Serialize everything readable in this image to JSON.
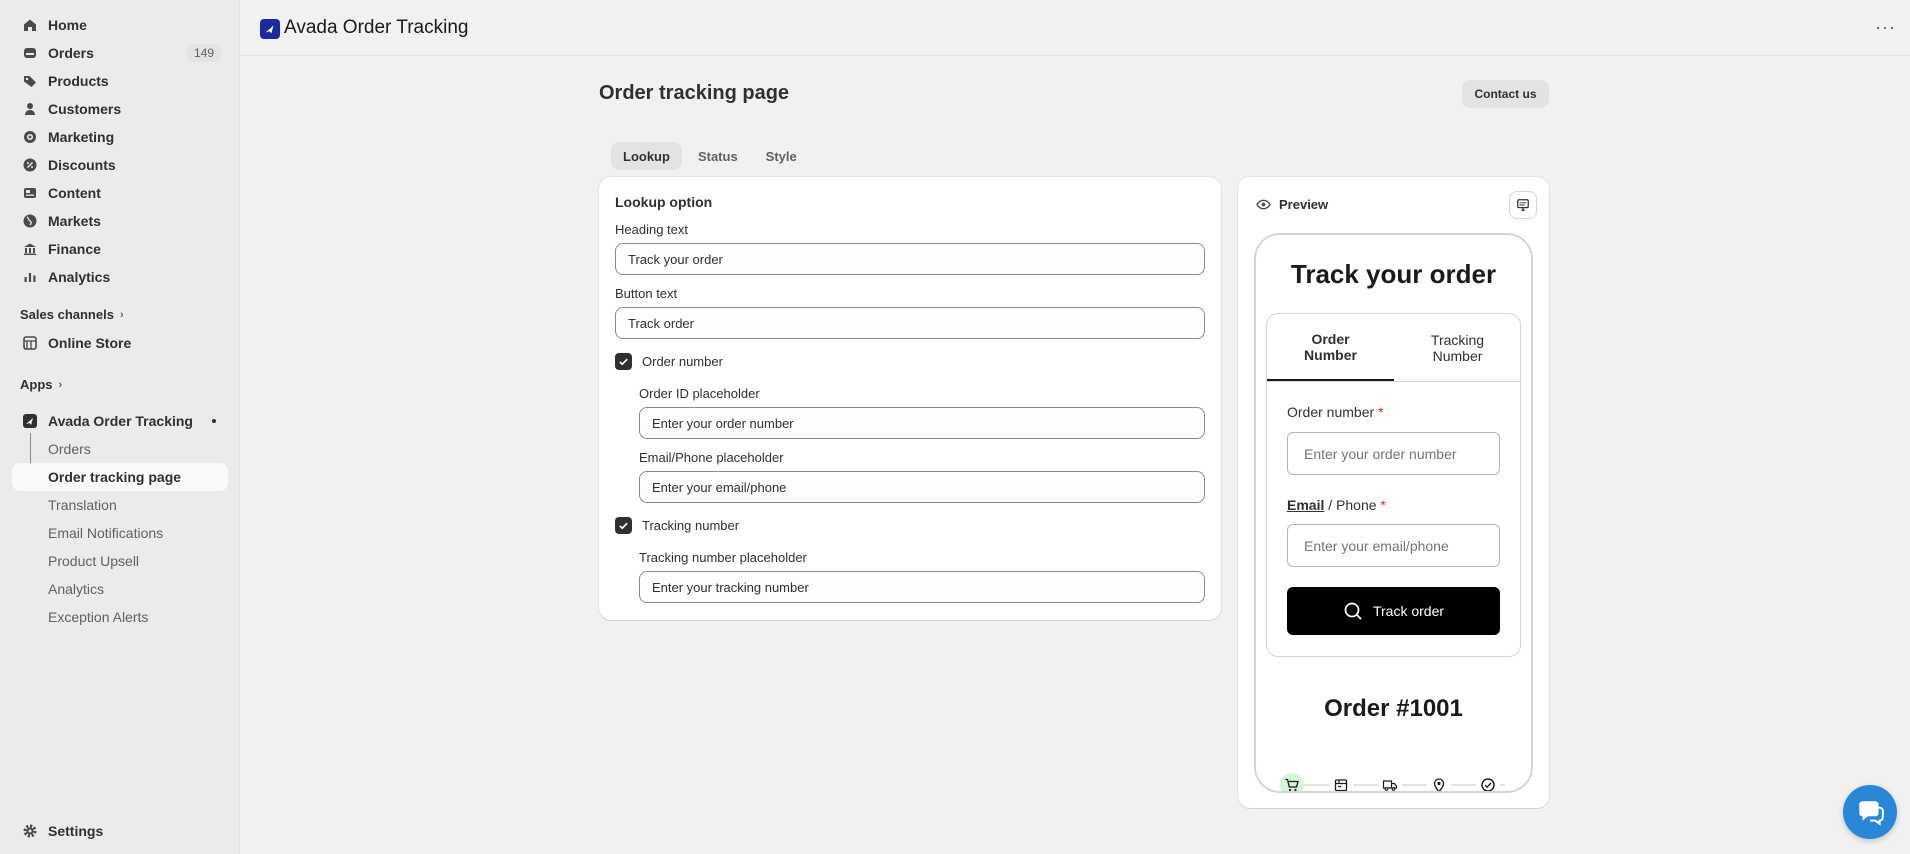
{
  "sidebar": {
    "items": [
      {
        "label": "Home",
        "icon": "home-icon"
      },
      {
        "label": "Orders",
        "icon": "orders-icon",
        "badge": "149"
      },
      {
        "label": "Products",
        "icon": "tag-icon"
      },
      {
        "label": "Customers",
        "icon": "person-icon"
      },
      {
        "label": "Marketing",
        "icon": "target-icon"
      },
      {
        "label": "Discounts",
        "icon": "discount-icon"
      },
      {
        "label": "Content",
        "icon": "content-icon"
      },
      {
        "label": "Markets",
        "icon": "globe-icon"
      },
      {
        "label": "Finance",
        "icon": "bank-icon"
      },
      {
        "label": "Analytics",
        "icon": "chart-icon"
      }
    ],
    "sales_channels_label": "Sales channels",
    "online_store_label": "Online Store",
    "apps_label": "Apps",
    "app_name": "Avada Order Tracking",
    "app_sub_items": [
      "Orders",
      "Order tracking page",
      "Translation",
      "Email Notifications",
      "Product Upsell",
      "Analytics",
      "Exception Alerts"
    ],
    "settings_label": "Settings"
  },
  "header": {
    "app_title": "Avada Order Tracking"
  },
  "page": {
    "title": "Order tracking page",
    "contact_label": "Contact us",
    "tabs": [
      "Lookup",
      "Status",
      "Style"
    ],
    "active_tab": "Lookup"
  },
  "form": {
    "section_title": "Lookup option",
    "heading_label": "Heading text",
    "heading_value": "Track your order",
    "button_label": "Button text",
    "button_value": "Track order",
    "order_number_check": "Order number",
    "order_id_label": "Order ID placeholder",
    "order_id_value": "Enter your order number",
    "email_label": "Email/Phone placeholder",
    "email_value": "Enter your email/phone",
    "tracking_check": "Tracking number",
    "tracking_label": "Tracking number placeholder",
    "tracking_value": "Enter your tracking number"
  },
  "preview": {
    "label": "Preview",
    "heading": "Track your order",
    "tab_order": "Order Number",
    "tab_tracking": "Tracking Number",
    "order_field_label": "Order number",
    "order_placeholder": "Enter your order number",
    "email_word": "Email",
    "phone_word": "/ Phone",
    "email_placeholder": "Enter your email/phone",
    "button_label": "Track order",
    "order_title": "Order #1001",
    "required_mark": "*",
    "steps": [
      "cart-icon",
      "package-icon",
      "truck-icon",
      "pin-icon",
      "check-circle-icon"
    ],
    "active_color": "#d4f5d7"
  },
  "colors": {
    "accent_black": "#000000",
    "required_red": "#d72c0d",
    "chat_blue": "#2a87d8",
    "app_logo": "#1d2a9c"
  }
}
